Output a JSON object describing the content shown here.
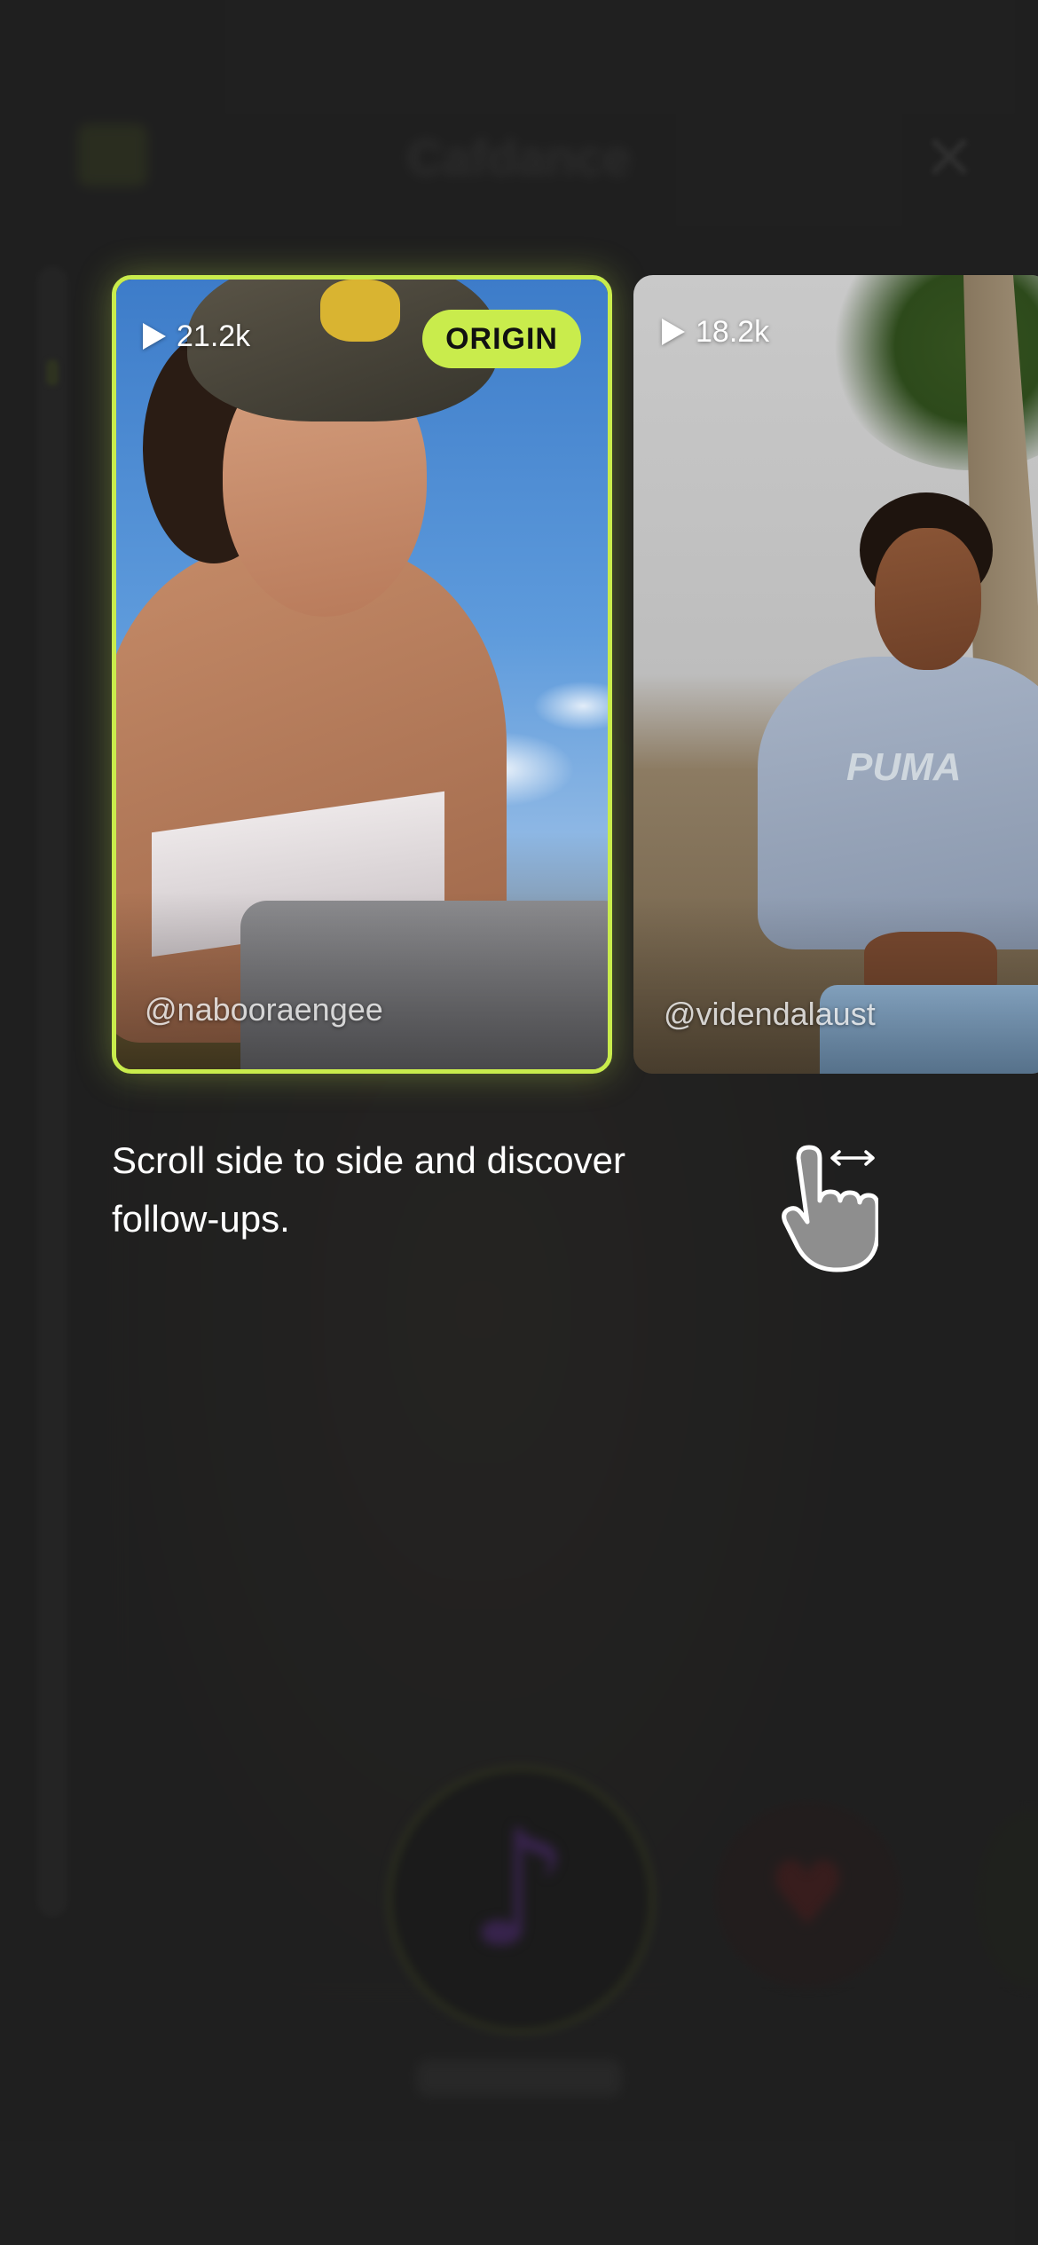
{
  "background": {
    "app_title": "Cafdance",
    "close_glyph": "✕",
    "nav_label": "Cafdance"
  },
  "cards": [
    {
      "views": "21.2k",
      "badge": "ORIGIN",
      "handle": "@nabooraengee",
      "highlighted": true,
      "highlight_color": "#c9ec4c"
    },
    {
      "views": "18.2k",
      "handle": "@videndalaust",
      "photo_text": "PUMA",
      "highlighted": false
    }
  ],
  "hint": {
    "text": "Scroll side to side and discover follow-ups.",
    "icon": "swipe-hand-icon"
  },
  "colors": {
    "accent": "#c9ec4c",
    "background": "#1e1e1e"
  }
}
